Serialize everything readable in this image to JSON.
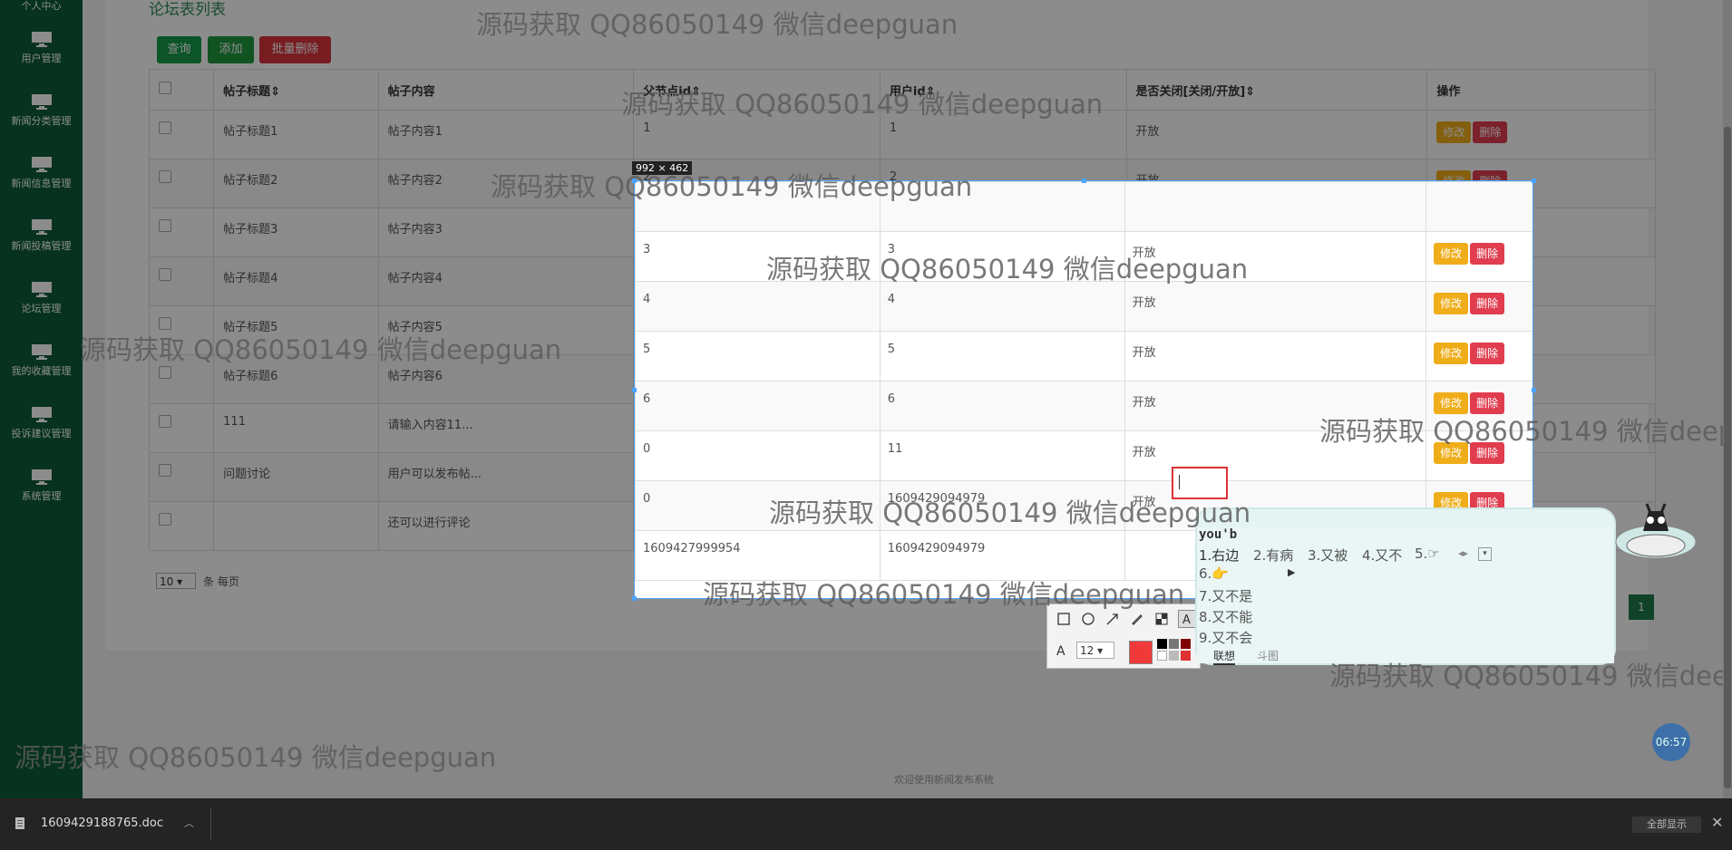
{
  "sidebar": {
    "top_item": "个人中心",
    "items": [
      {
        "label": "用户管理"
      },
      {
        "label": "新闻分类管理"
      },
      {
        "label": "新闻信息管理"
      },
      {
        "label": "新闻投稿管理"
      },
      {
        "label": "论坛管理"
      },
      {
        "label": "我的收藏管理"
      },
      {
        "label": "投诉建议管理"
      },
      {
        "label": "系统管理"
      }
    ]
  },
  "page": {
    "title": "论坛表列表",
    "buttons": {
      "query": "查询",
      "add": "添加",
      "batch_delete": "批量删除"
    },
    "columns": [
      "帖子标题",
      "帖子内容",
      "父节点id",
      "用户id",
      "是否关闭[关闭/开放]",
      "操作"
    ],
    "rows": [
      {
        "title": "帖子标题1",
        "content": "帖子内容1",
        "parent": "1",
        "user": "1",
        "status": "开放"
      },
      {
        "title": "帖子标题2",
        "content": "帖子内容2",
        "parent": "2",
        "user": "2",
        "status": "开放"
      },
      {
        "title": "帖子标题3",
        "content": "帖子内容3",
        "parent": "3",
        "user": "3",
        "status": "开放"
      },
      {
        "title": "帖子标题4",
        "content": "帖子内容4",
        "parent": "4",
        "user": "4",
        "status": "开放"
      },
      {
        "title": "帖子标题5",
        "content": "帖子内容5",
        "parent": "5",
        "user": "5",
        "status": "开放"
      },
      {
        "title": "帖子标题6",
        "content": "帖子内容6",
        "parent": "6",
        "user": "6",
        "status": "开放"
      },
      {
        "title": "111",
        "content": "请输入内容11...",
        "parent": "0",
        "user": "11",
        "status": "开放"
      },
      {
        "title": "问题讨论",
        "content": "用户可以发布帖...",
        "parent": "0",
        "user": "1609429094979",
        "status": "开放"
      },
      {
        "title": "",
        "content": "还可以进行评论",
        "parent": "1609427999954",
        "user": "1609429094979",
        "status": ""
      }
    ],
    "row_actions": {
      "edit": "修改",
      "delete": "删除"
    },
    "page_size": "10",
    "page_size_suffix": "条 每页",
    "current_page": "1",
    "footer": "欢迎使用新闻发布系统"
  },
  "screenshot_tool": {
    "size_label": "992 × 462",
    "font_size": "12",
    "tools": [
      "rect-icon",
      "ellipse-icon",
      "arrow-icon",
      "pencil-icon",
      "mosaic-icon",
      "text-icon"
    ],
    "selected_color": "#f03a3a"
  },
  "ime": {
    "composition": "you'b",
    "candidates": [
      "1.右边",
      "2.有病",
      "3.又被",
      "4.又不",
      "5.☞"
    ],
    "more": [
      "6.👉",
      "7.又不是",
      "8.又不能",
      "9.又不会"
    ],
    "tab_lianxiang": "联想",
    "tab_doutu": "斗图"
  },
  "watermark": "源码获取 QQ86050149 微信deepguan",
  "clock": "06:57",
  "download": {
    "filename": "1609429188765.doc",
    "show_all": "全部显示"
  },
  "colors": {
    "sidebar": "#0b5c3a",
    "query": "#169b4a",
    "add": "#1f9a3d",
    "batch_delete": "#d9363e",
    "edit": "#f0ad1a",
    "delete": "#e03d4f"
  }
}
